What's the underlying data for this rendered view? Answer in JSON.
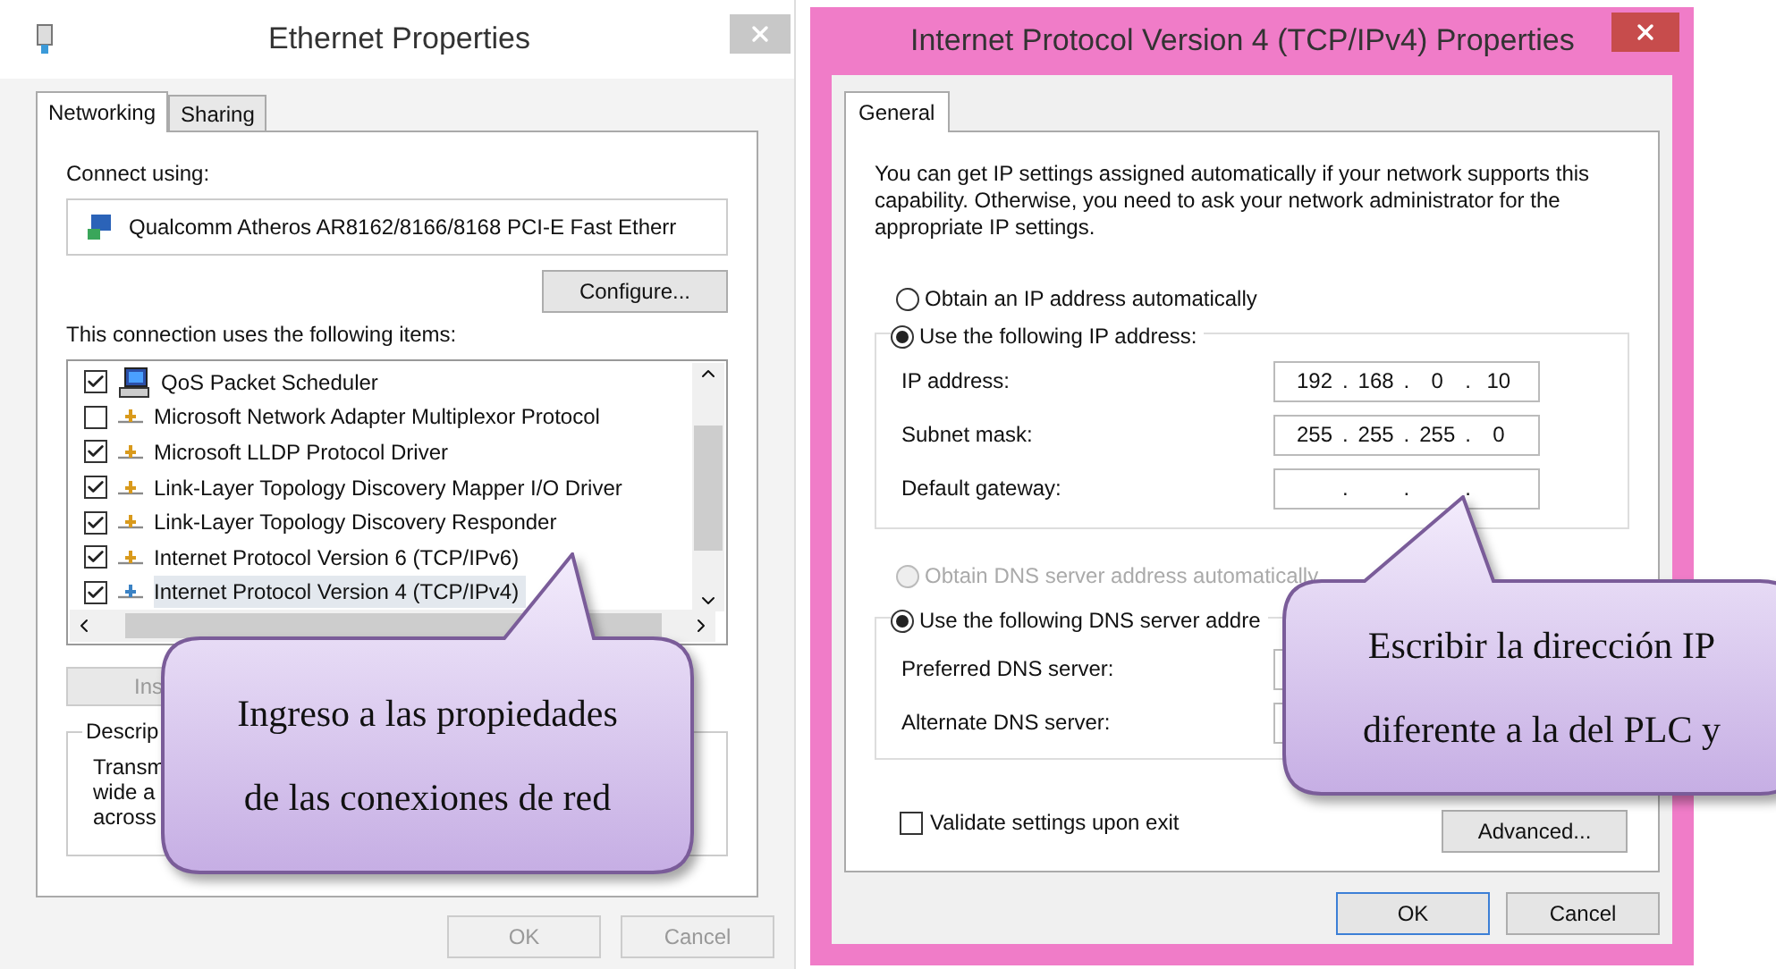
{
  "ethernet_window": {
    "title": "Ethernet Properties",
    "tabs": [
      {
        "label": "Networking",
        "selected": true
      },
      {
        "label": "Sharing",
        "selected": false
      }
    ],
    "connect_using_label": "Connect using:",
    "adapter": "Qualcomm Atheros AR8162/8166/8168 PCI-E Fast Etherr",
    "configure_button": "Configure...",
    "items_label": "This connection uses the following items:",
    "items": [
      {
        "label": "QoS Packet Scheduler",
        "checked": true,
        "kind": "scheduler",
        "selected": false
      },
      {
        "label": "Microsoft Network Adapter Multiplexor Protocol",
        "checked": false,
        "kind": "protocol",
        "selected": false
      },
      {
        "label": "Microsoft LLDP Protocol Driver",
        "checked": true,
        "kind": "protocol",
        "selected": false
      },
      {
        "label": "Link-Layer Topology Discovery Mapper I/O Driver",
        "checked": true,
        "kind": "protocol",
        "selected": false
      },
      {
        "label": "Link-Layer Topology Discovery Responder",
        "checked": true,
        "kind": "protocol",
        "selected": false
      },
      {
        "label": "Internet Protocol Version 6 (TCP/IPv6)",
        "checked": true,
        "kind": "protocol",
        "selected": false
      },
      {
        "label": "Internet Protocol Version 4 (TCP/IPv4)",
        "checked": true,
        "kind": "protocol",
        "selected": true
      }
    ],
    "install_button": "Ins",
    "description": {
      "legend": "Descrip",
      "lines": [
        "Transm",
        "wide a",
        "across"
      ]
    },
    "buttons": [
      {
        "label": "OK",
        "disabled": true
      },
      {
        "label": "Cancel",
        "disabled": true
      }
    ]
  },
  "ipv4_window": {
    "title": "Internet Protocol Version 4 (TCP/IPv4) Properties",
    "tabs": [
      {
        "label": "General",
        "selected": true
      }
    ],
    "intro": "You can get IP settings assigned automatically if your network supports this capability. Otherwise, you need to ask your network administrator for the appropriate IP settings.",
    "ip_mode": [
      {
        "label": "Obtain an IP address automatically",
        "selected": false,
        "disabled": false
      },
      {
        "label": "Use the following IP address:",
        "selected": true,
        "disabled": false
      }
    ],
    "separator": ".",
    "ip_fields": [
      {
        "label": "IP address:",
        "octets": [
          "192",
          "168",
          "0",
          "10"
        ]
      },
      {
        "label": "Subnet mask:",
        "octets": [
          "255",
          "255",
          "255",
          "0"
        ]
      },
      {
        "label": "Default gateway:"
      }
    ],
    "dns_mode": [
      {
        "label": "Obtain DNS server address automatically",
        "selected": false,
        "disabled": true
      },
      {
        "label": "Use the following DNS server addre",
        "selected": true,
        "disabled": false
      }
    ],
    "dns_fields": [
      {
        "label": "Preferred DNS server:"
      },
      {
        "label": "Alternate DNS server:"
      }
    ],
    "validate": {
      "label": "Validate settings upon exit",
      "checked": false
    },
    "advanced_button": "Advanced...",
    "buttons": [
      {
        "label": "OK",
        "default": true
      },
      {
        "label": "Cancel",
        "default": false
      }
    ]
  },
  "callouts": [
    {
      "lines": [
        "Ingreso a las propiedades",
        "de las conexiones de red"
      ]
    },
    {
      "lines": [
        "Escribir la dirección IP",
        "diferente a la del PLC y"
      ]
    }
  ]
}
